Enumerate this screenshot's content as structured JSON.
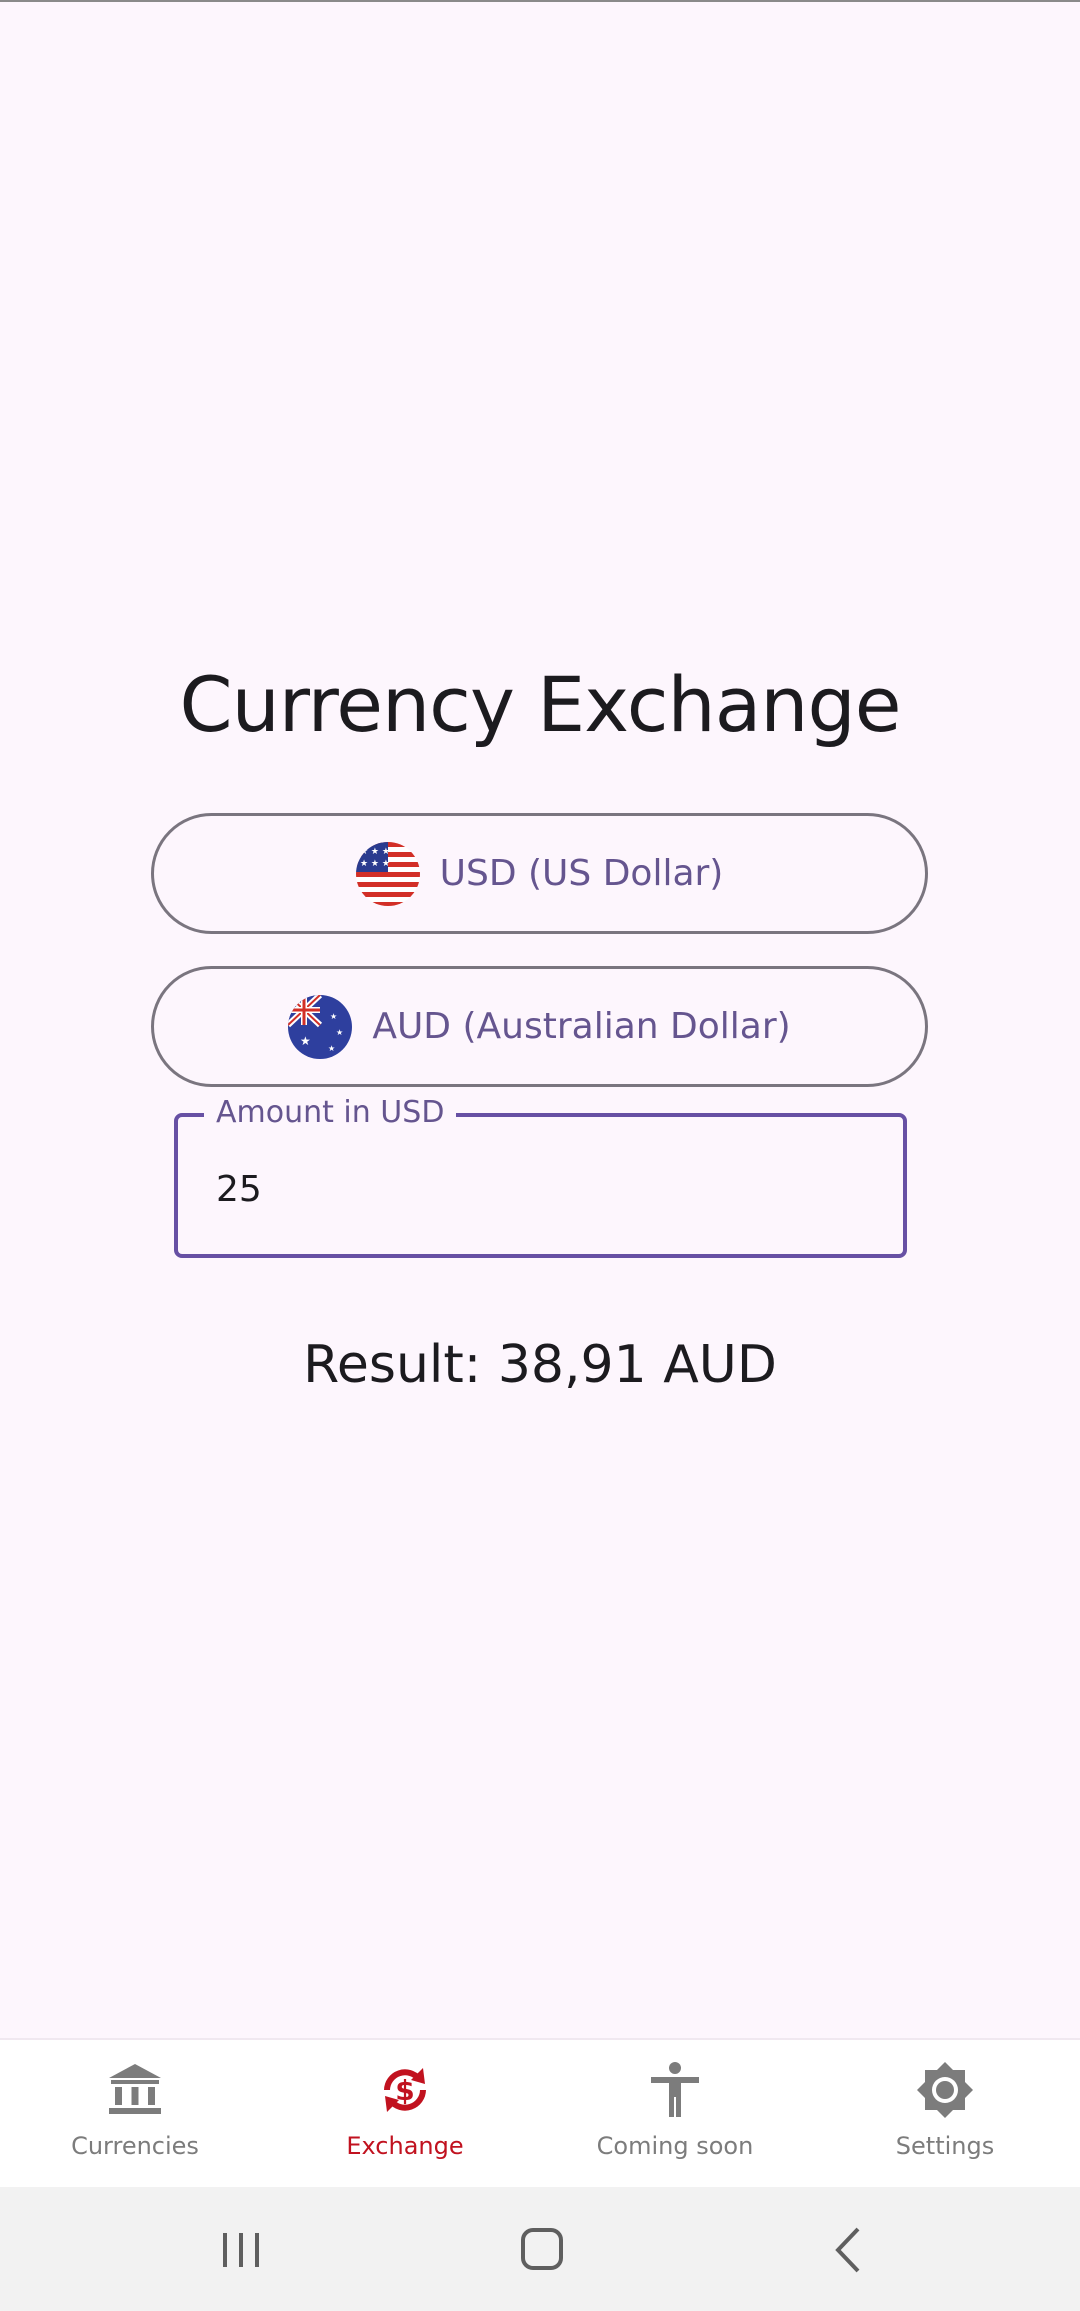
{
  "page": {
    "title": "Currency Exchange"
  },
  "from_currency": {
    "label": "USD (US Dollar)",
    "flag_icon": "us-flag-icon"
  },
  "to_currency": {
    "label": "AUD (Australian Dollar)",
    "flag_icon": "australia-flag-icon"
  },
  "amount": {
    "label": "Amount in USD",
    "value": "25"
  },
  "result": {
    "text": "Result: 38,91 AUD"
  },
  "bottom_nav": {
    "items": [
      {
        "label": "Currencies",
        "icon": "bank-icon",
        "active": false
      },
      {
        "label": "Exchange",
        "icon": "currency-exchange-icon",
        "active": true
      },
      {
        "label": "Coming soon",
        "icon": "accessibility-icon",
        "active": false
      },
      {
        "label": "Settings",
        "icon": "settings-icon",
        "active": false
      }
    ]
  },
  "system_nav": {
    "buttons": [
      "recent-apps-icon",
      "home-icon",
      "back-icon"
    ]
  },
  "colors": {
    "background": "#fdf6fd",
    "primary": "#6750a4",
    "on_surface_variant": "#65558f",
    "active_nav": "#c1121f",
    "inactive_nav": "#7c7c7c"
  }
}
